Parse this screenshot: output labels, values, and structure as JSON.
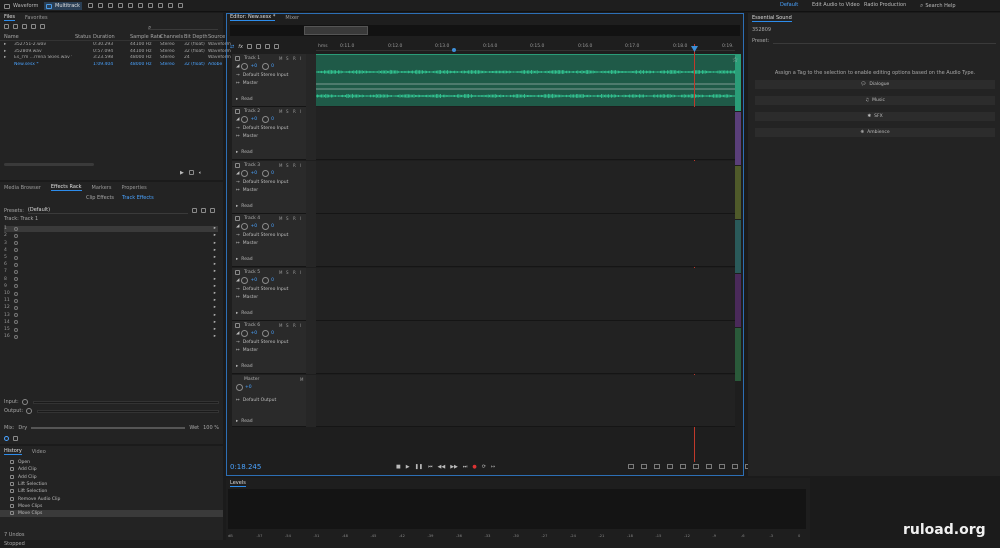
{
  "topbar": {
    "waveform": "Waveform",
    "multitrack": "Multitrack",
    "workspaces": [
      "Default",
      "Edit Audio to Video",
      "Radio Production"
    ],
    "search_placeholder": "Search Help"
  },
  "files_panel": {
    "tabs": [
      "Files",
      "Favorites"
    ],
    "columns": [
      "Name",
      "Status",
      "Duration",
      "Sample Rate",
      "Channels",
      "Bit Depth",
      "Source"
    ],
    "rows": [
      {
        "name": "352751-2.wav",
        "status": "",
        "duration": "0:30.293",
        "rate": "44100 Hz",
        "channels": "Stereo",
        "depth": "32 (float)",
        "source": "Waveform"
      },
      {
        "name": "352809.wav",
        "status": "",
        "duration": "0:57.094",
        "rate": "44100 Hz",
        "channels": "Stereo",
        "depth": "32 (float)",
        "source": "Waveform"
      },
      {
        "name": "Es_I'm ...rrena Skies.wav *",
        "status": "",
        "duration": "3:23.598",
        "rate": "48000 Hz",
        "channels": "Stereo",
        "depth": "24",
        "source": "Waveform"
      },
      {
        "name": "New.sesx *",
        "status": "",
        "duration": "1:09.404",
        "rate": "48000 Hz",
        "channels": "Stereo",
        "depth": "32 (float)",
        "source": "Adobe"
      }
    ]
  },
  "effects_panel": {
    "tabs": [
      "Media Browser",
      "Effects Rack",
      "Markers",
      "Properties"
    ],
    "subtabs": [
      "Clip Effects",
      "Track Effects"
    ],
    "presets_label": "Presets:",
    "presets_value": "(Default)",
    "track_label": "Track: Track 1",
    "slots": [
      "1",
      "2",
      "3",
      "4",
      "5",
      "6",
      "7",
      "8",
      "9",
      "10",
      "11",
      "12",
      "13",
      "14",
      "15",
      "16"
    ],
    "input_label": "Input:",
    "output_label": "Output:",
    "mix_label": "Mix:",
    "dry_label": "Dry",
    "wet_label": "Wet",
    "mix_value": "100 %"
  },
  "history_panel": {
    "tabs": [
      "History",
      "Video"
    ],
    "items": [
      "Open",
      "Add Clip",
      "Add Clip",
      "Lift Selection",
      "Lift Selection",
      "Remove Audio Clip",
      "Move Clips",
      "Move Clips"
    ],
    "undos": "7 Undos",
    "status": "Stopped"
  },
  "editor": {
    "tabs": [
      "Editor: New.sesx *",
      "Mixer"
    ],
    "ruler": [
      "hms",
      "0:11.0",
      "0:12.0",
      "0:13.0",
      "0:14.0",
      "0:15.0",
      "0:16.0",
      "0:17.0",
      "0:18.0",
      "0:19."
    ],
    "time": "0:18.245",
    "clip_name": "352809",
    "clip_pan": "Pan"
  },
  "tracks": [
    {
      "name": "Track 1",
      "vol": "+0",
      "pan": "0",
      "input": "Default Stereo Input",
      "output": "Master",
      "auto": "Read"
    },
    {
      "name": "Track 2",
      "vol": "+0",
      "pan": "0",
      "input": "Default Stereo Input",
      "output": "Master",
      "auto": "Read"
    },
    {
      "name": "Track 3",
      "vol": "+0",
      "pan": "0",
      "input": "Default Stereo Input",
      "output": "Master",
      "auto": "Read"
    },
    {
      "name": "Track 4",
      "vol": "+0",
      "pan": "0",
      "input": "Default Stereo Input",
      "output": "Master",
      "auto": "Read"
    },
    {
      "name": "Track 5",
      "vol": "+0",
      "pan": "0",
      "input": "Default Stereo Input",
      "output": "Master",
      "auto": "Read"
    },
    {
      "name": "Track 6",
      "vol": "+0",
      "pan": "0",
      "input": "Default Stereo Input",
      "output": "Master",
      "auto": "Read"
    }
  ],
  "master": {
    "name": "Master",
    "vol": "+0",
    "output": "Default Output",
    "auto": "Read"
  },
  "mrs": {
    "m": "M",
    "s": "S",
    "r": "R",
    "i": "I"
  },
  "levels": {
    "title": "Levels",
    "scale": [
      "dB",
      "-57",
      "-54",
      "-51",
      "-48",
      "-45",
      "-42",
      "-39",
      "-36",
      "-33",
      "-30",
      "-27",
      "-24",
      "-21",
      "-18",
      "-15",
      "-12",
      "-9",
      "-6",
      "-3",
      "0"
    ]
  },
  "essential_sound": {
    "title": "Essential Sound",
    "clip": "352809",
    "preset_label": "Preset:",
    "hint": "Assign a Tag to the selection to enable editing options based on the Audio Type.",
    "buttons": [
      "Dialogue",
      "Music",
      "SFX",
      "Ambience"
    ]
  },
  "watermark": "ruload.org",
  "colors": {
    "accent": "#2d8ceb",
    "track1": "#2a9d78",
    "clip2": "#8b35c9",
    "playhead": "#c0392b"
  }
}
